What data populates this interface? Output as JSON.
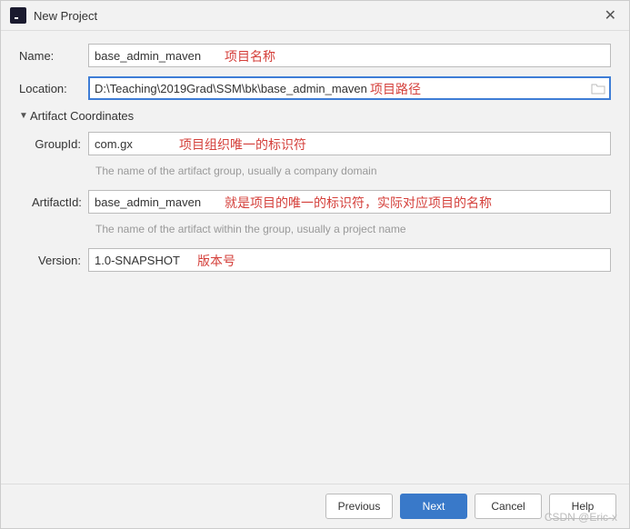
{
  "window": {
    "title": "New Project"
  },
  "fields": {
    "name": {
      "label": "Name:",
      "value": "base_admin_maven",
      "annotation": "项目名称"
    },
    "location": {
      "label": "Location:",
      "value": "D:\\Teaching\\2019Grad\\SSM\\bk\\base_admin_maven",
      "annotation": "项目路径"
    }
  },
  "artifact_section": {
    "title": "Artifact Coordinates",
    "groupId": {
      "label": "GroupId:",
      "value": "com.gx",
      "annotation": "项目组织唯一的标识符",
      "help": "The name of the artifact group, usually a company domain"
    },
    "artifactId": {
      "label": "ArtifactId:",
      "value": "base_admin_maven",
      "annotation": "就是项目的唯一的标识符，实际对应项目的名称",
      "help": "The name of the artifact within the group, usually a project name"
    },
    "version": {
      "label": "Version:",
      "value": "1.0-SNAPSHOT",
      "annotation": "版本号"
    }
  },
  "buttons": {
    "previous": "Previous",
    "next": "Next",
    "cancel": "Cancel",
    "help": "Help"
  },
  "watermark": "CSDN @Eric-x"
}
